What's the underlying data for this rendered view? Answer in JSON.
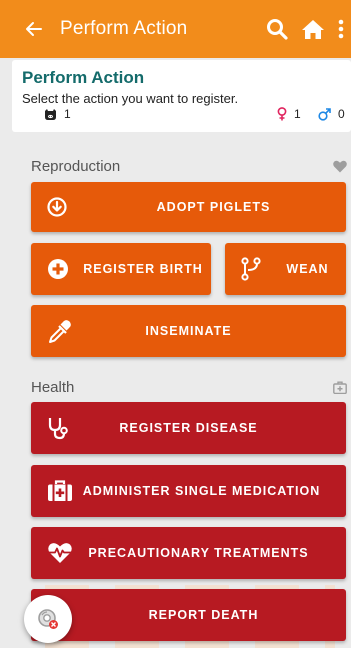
{
  "topbar": {
    "title": "Perform Action",
    "icons": [
      "back-arrow-icon",
      "search-icon",
      "home-icon",
      "more-vertical-icon"
    ]
  },
  "summary": {
    "title": "Perform Action",
    "subtitle": "Select the action you want to register.",
    "pig_count": "1",
    "female_count": "1",
    "male_count": "0"
  },
  "sections": {
    "reproduction": {
      "label": "Reproduction",
      "icon": "heart-icon",
      "actions": {
        "adopt_piglets": "ADOPT PIGLETS",
        "register_birth": "REGISTER BIRTH",
        "wean": "WEAN",
        "inseminate": "INSEMINATE"
      }
    },
    "health": {
      "label": "Health",
      "icon": "medical-kit-icon",
      "actions": {
        "register_disease": "REGISTER DISEASE",
        "administer_single_medication": "ADMINISTER SINGLE MEDICATION",
        "precautionary_treatments": "PRECAUTIONARY TREATMENTS",
        "report_death": "REPORT DEATH"
      }
    }
  },
  "colors": {
    "topbar": "#f28c1b",
    "reproduction_button": "#e65a0a",
    "health_button": "#b71a22",
    "summary_title": "#146b6b",
    "female": "#e0245e",
    "male": "#1e88e5"
  }
}
